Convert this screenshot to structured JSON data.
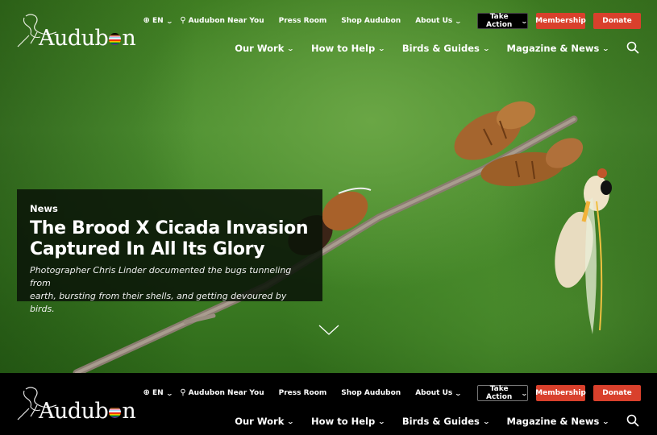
{
  "brand": {
    "logo_text_pre": "Audub",
    "logo_text_post": "n",
    "colors": {
      "accent_red": "#d9402c",
      "hero_green": "#4d8f30",
      "header_black": "#000000"
    }
  },
  "header": {
    "utility": {
      "language": "EN",
      "near_you": "Audubon Near You",
      "press_room": "Press Room",
      "shop": "Shop Audubon",
      "about": "About Us"
    },
    "buttons": {
      "take_action": "Take Action",
      "membership": "Membership",
      "donate": "Donate"
    },
    "nav": [
      {
        "label": "Our Work"
      },
      {
        "label": "How to Help"
      },
      {
        "label": "Birds & Guides"
      },
      {
        "label": "Magazine & News"
      }
    ],
    "icons": {
      "globe": "globe-icon",
      "pin": "map-pin-icon",
      "chevron": "chevron-down-icon",
      "search": "search-icon"
    }
  },
  "hero": {
    "kicker": "News",
    "title_line1": "The Brood X Cicada Invasion",
    "title_line2": "Captured In All Its Glory",
    "description_line1": "Photographer Chris Linder documented the bugs tunneling from",
    "description_line2": "earth, bursting from their shells, and getting devoured by birds.",
    "image_subject": "Cicadas and molted shells on a twig against a green background"
  }
}
